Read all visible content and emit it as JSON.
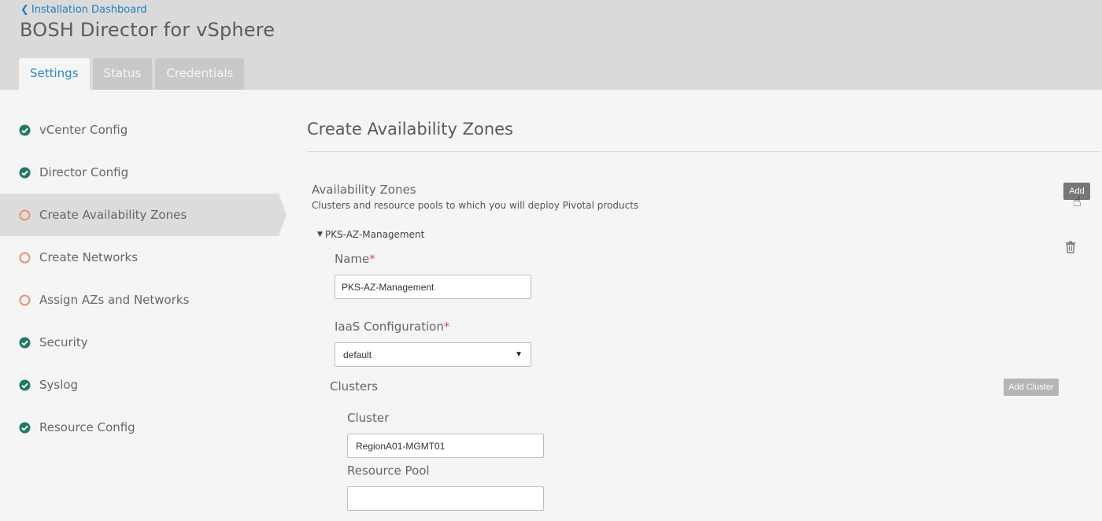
{
  "header": {
    "back_link": "Installation Dashboard",
    "title": "BOSH Director for vSphere",
    "tabs": [
      {
        "label": "Settings",
        "active": true
      },
      {
        "label": "Status",
        "active": false
      },
      {
        "label": "Credentials",
        "active": false
      }
    ]
  },
  "sidebar": {
    "items": [
      {
        "label": "vCenter Config",
        "status": "complete"
      },
      {
        "label": "Director Config",
        "status": "complete"
      },
      {
        "label": "Create Availability Zones",
        "status": "incomplete",
        "active": true
      },
      {
        "label": "Create Networks",
        "status": "incomplete"
      },
      {
        "label": "Assign AZs and Networks",
        "status": "incomplete"
      },
      {
        "label": "Security",
        "status": "complete"
      },
      {
        "label": "Syslog",
        "status": "complete"
      },
      {
        "label": "Resource Config",
        "status": "complete"
      }
    ]
  },
  "main": {
    "section_title": "Create Availability Zones",
    "az_label": "Availability Zones",
    "az_description": "Clusters and resource pools to which you will deploy Pivotal products",
    "add_button": "Add",
    "az_item": {
      "title": "PKS-AZ-Management",
      "name_label": "Name",
      "required_mark": "*",
      "name_value": "PKS-AZ-Management",
      "iaas_label": "IaaS Configuration",
      "iaas_value": "default",
      "clusters_label": "Clusters",
      "add_cluster_button": "Add Cluster",
      "cluster_label": "Cluster",
      "cluster_value": "RegionA01-MGMT01",
      "resource_pool_label": "Resource Pool",
      "resource_pool_value": ""
    }
  },
  "colors": {
    "complete": "#1e7a64",
    "incomplete": "#e8926f",
    "link": "#1f7fba",
    "required": "#d9534f"
  }
}
